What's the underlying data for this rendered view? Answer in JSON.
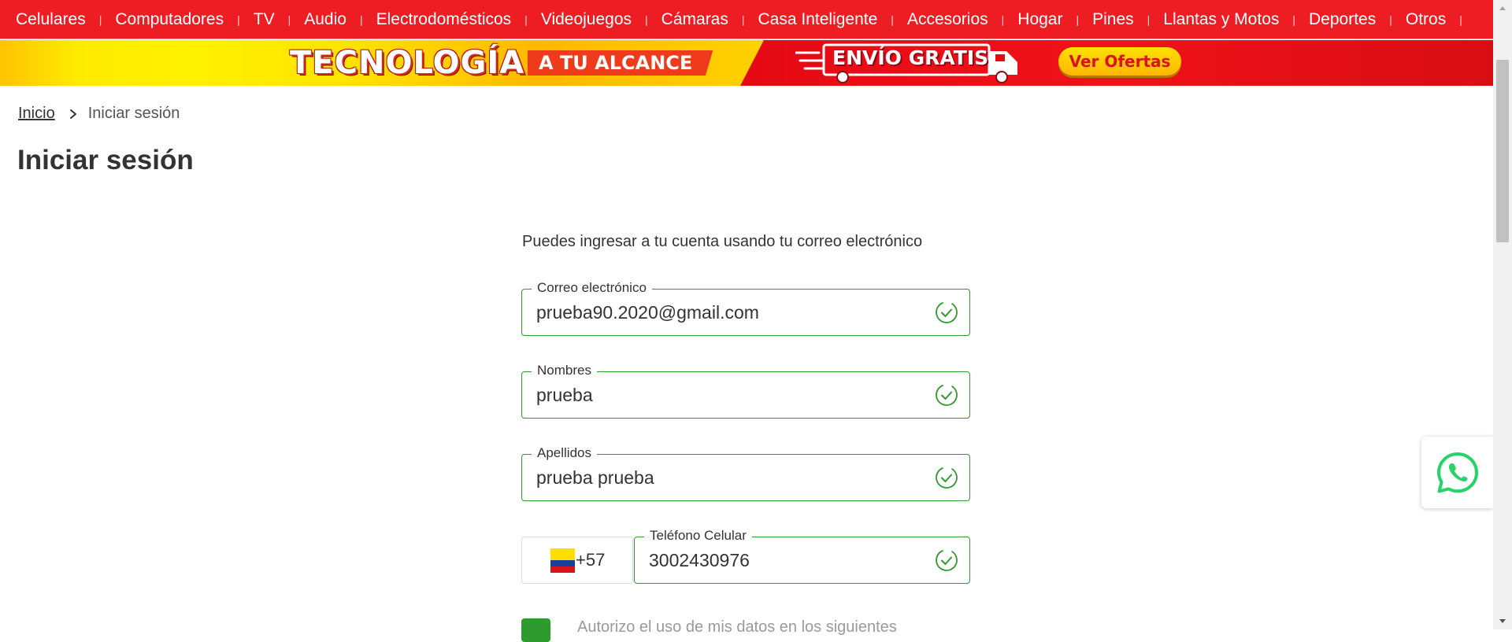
{
  "nav": {
    "items": [
      "Celulares",
      "Computadores",
      "TV",
      "Audio",
      "Electrodomésticos",
      "Videojuegos",
      "Cámaras",
      "Casa Inteligente",
      "Accesorios",
      "Hogar",
      "Pines",
      "Llantas y Motos",
      "Deportes",
      "Otros"
    ],
    "more_icon": "chevron-down-icon"
  },
  "banner": {
    "tecnologia": "TECNOLOGÍA",
    "alcance": "A TU ALCANCE",
    "envio": "ENVÍO GRATIS",
    "ofertas": "Ver Ofertas"
  },
  "breadcrumb": {
    "home": "Inicio",
    "current": "Iniciar sesión"
  },
  "page": {
    "title": "Iniciar sesión",
    "intro": "Puedes ingresar a tu cuenta usando tu correo electrónico"
  },
  "form": {
    "email": {
      "label": "Correo electrónico",
      "value": "prueba90.2020@gmail.com"
    },
    "nombres": {
      "label": "Nombres",
      "value": "prueba"
    },
    "apellidos": {
      "label": "Apellidos",
      "value": "prueba prueba"
    },
    "phone": {
      "label": "Teléfono Celular",
      "value": "3002430976",
      "dial_code": "+57",
      "country_flag": "colombia-flag-icon"
    },
    "consent_text": "Autorizo el uso de mis datos en los siguientes"
  },
  "colors": {
    "nav_red": "#ee1d23",
    "valid_green": "#2e9b2e",
    "whatsapp_green": "#25d366"
  }
}
